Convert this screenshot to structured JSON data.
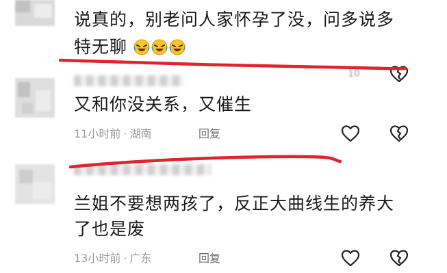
{
  "comments": [
    {
      "text_line1": "说真的，别老问人家怀孕了没，问多说多",
      "text_line2": "特无聊",
      "emoji": [
        "laughing-tears",
        "laughing-tears",
        "laughing-tears"
      ],
      "like_count": "10"
    },
    {
      "text": "又和你没关系，又催生",
      "time": "11小时前",
      "location": "湖南",
      "reply_label": "回复"
    },
    {
      "text_line1": "兰姐不要想两孩了，反正大曲线生的养大",
      "text_line2": "了也是废",
      "time": "13小时前",
      "location": "广东",
      "reply_label": "回复"
    }
  ],
  "meta_separator": "·",
  "colors": {
    "text": "#1a1a1a",
    "meta": "#9a9a9a",
    "highlight_stroke": "#e0232e"
  },
  "icons": [
    "heart-outline-icon",
    "broken-heart-icon"
  ]
}
